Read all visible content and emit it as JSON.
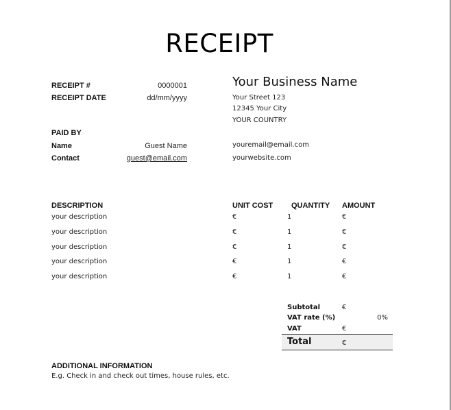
{
  "title": "RECEIPT",
  "receipt": {
    "number_label": "RECEIPT #",
    "number_value": "0000001",
    "date_label": "RECEIPT DATE",
    "date_value": "dd/mm/yyyy"
  },
  "paid_by": {
    "heading": "PAID BY",
    "name_label": "Name",
    "name_value": "Guest Name",
    "contact_label": "Contact",
    "contact_value": "guest@email.com"
  },
  "business": {
    "name": "Your Business Name",
    "street": "Your Street 123",
    "city": "12345 Your City",
    "country": "YOUR COUNTRY",
    "email": "youremail@email.com",
    "website": "yourwebsite.com"
  },
  "items_table": {
    "headers": [
      "DESCRIPTION",
      "UNIT COST",
      "QUANTITY",
      "AMOUNT"
    ],
    "rows": [
      {
        "description": "your description",
        "unit_cost": "€",
        "quantity": "1",
        "amount": "€"
      },
      {
        "description": "your description",
        "unit_cost": "€",
        "quantity": "1",
        "amount": "€"
      },
      {
        "description": "your description",
        "unit_cost": "€",
        "quantity": "1",
        "amount": "€"
      },
      {
        "description": "your description",
        "unit_cost": "€",
        "quantity": "1",
        "amount": "€"
      },
      {
        "description": "your description",
        "unit_cost": "€",
        "quantity": "1",
        "amount": "€"
      }
    ]
  },
  "summary": {
    "subtotal_label": "Subtotal",
    "subtotal_value": "€",
    "vat_rate_label": "VAT rate (%)",
    "vat_rate_value": "0%",
    "vat_label": "VAT",
    "vat_value": "€",
    "total_label": "Total",
    "total_value": "€"
  },
  "additional": {
    "heading": "ADDITIONAL INFORMATION",
    "text": "E.g.  Check in and check out times, house rules, etc."
  }
}
